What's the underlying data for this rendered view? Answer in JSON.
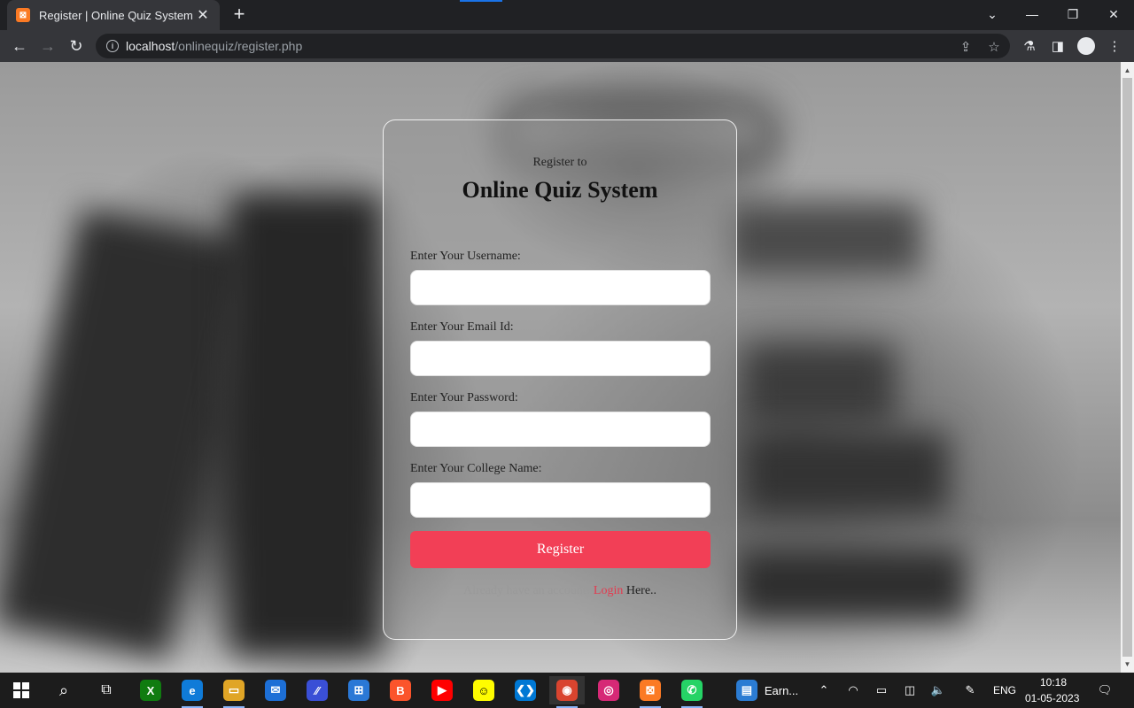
{
  "browser": {
    "tab": {
      "title": "Register | Online Quiz System",
      "favicon": "xampp-icon"
    },
    "url": {
      "host": "localhost",
      "path": "/onlinequiz/register.php"
    }
  },
  "page": {
    "subtitle": "Register to",
    "title": "Online Quiz System",
    "fields": [
      {
        "label": "Enter Your Username:",
        "value": ""
      },
      {
        "label": "Enter Your Email Id:",
        "value": ""
      },
      {
        "label": "Enter Your Password:",
        "value": ""
      },
      {
        "label": "Enter Your College Name:",
        "value": ""
      }
    ],
    "register_button": "Register",
    "login_prompt": {
      "faded": "Already have an account!",
      "link": "Login",
      "suffix": "Here.."
    },
    "colors": {
      "accent": "#f23f56",
      "link": "#e33a4f"
    }
  },
  "taskbar": {
    "apps": [
      {
        "name": "xbox-icon",
        "glyph": "X",
        "color": "#107c10"
      },
      {
        "name": "edge-icon",
        "glyph": "e",
        "color": "#0f7bd8"
      },
      {
        "name": "file-explorer-icon",
        "glyph": "▭",
        "color": "#e0a526"
      },
      {
        "name": "mail-icon",
        "glyph": "✉",
        "color": "#1d6fd6"
      },
      {
        "name": "powerautomate-icon",
        "glyph": "⁄⁄",
        "color": "#3a4fd6"
      },
      {
        "name": "store-icon",
        "glyph": "⊞",
        "color": "#2a78d6"
      },
      {
        "name": "brave-icon",
        "glyph": "B",
        "color": "#fb542b"
      },
      {
        "name": "youtube-icon",
        "glyph": "▶",
        "color": "#ff0000"
      },
      {
        "name": "snapchat-icon",
        "glyph": "☺",
        "color": "#fffc00"
      },
      {
        "name": "vscode-icon",
        "glyph": "❮❯",
        "color": "#0078d4"
      },
      {
        "name": "chrome-dev-icon",
        "glyph": "◉",
        "color": "#d9442f"
      },
      {
        "name": "instagram-icon",
        "glyph": "◎",
        "color": "#d62976"
      },
      {
        "name": "xampp-icon",
        "glyph": "⊠",
        "color": "#fb7a24"
      },
      {
        "name": "whatsapp-icon",
        "glyph": "✆",
        "color": "#25d366"
      }
    ],
    "doc_item": "Earn...",
    "language": "ENG",
    "time": "10:18",
    "date": "01-05-2023"
  }
}
